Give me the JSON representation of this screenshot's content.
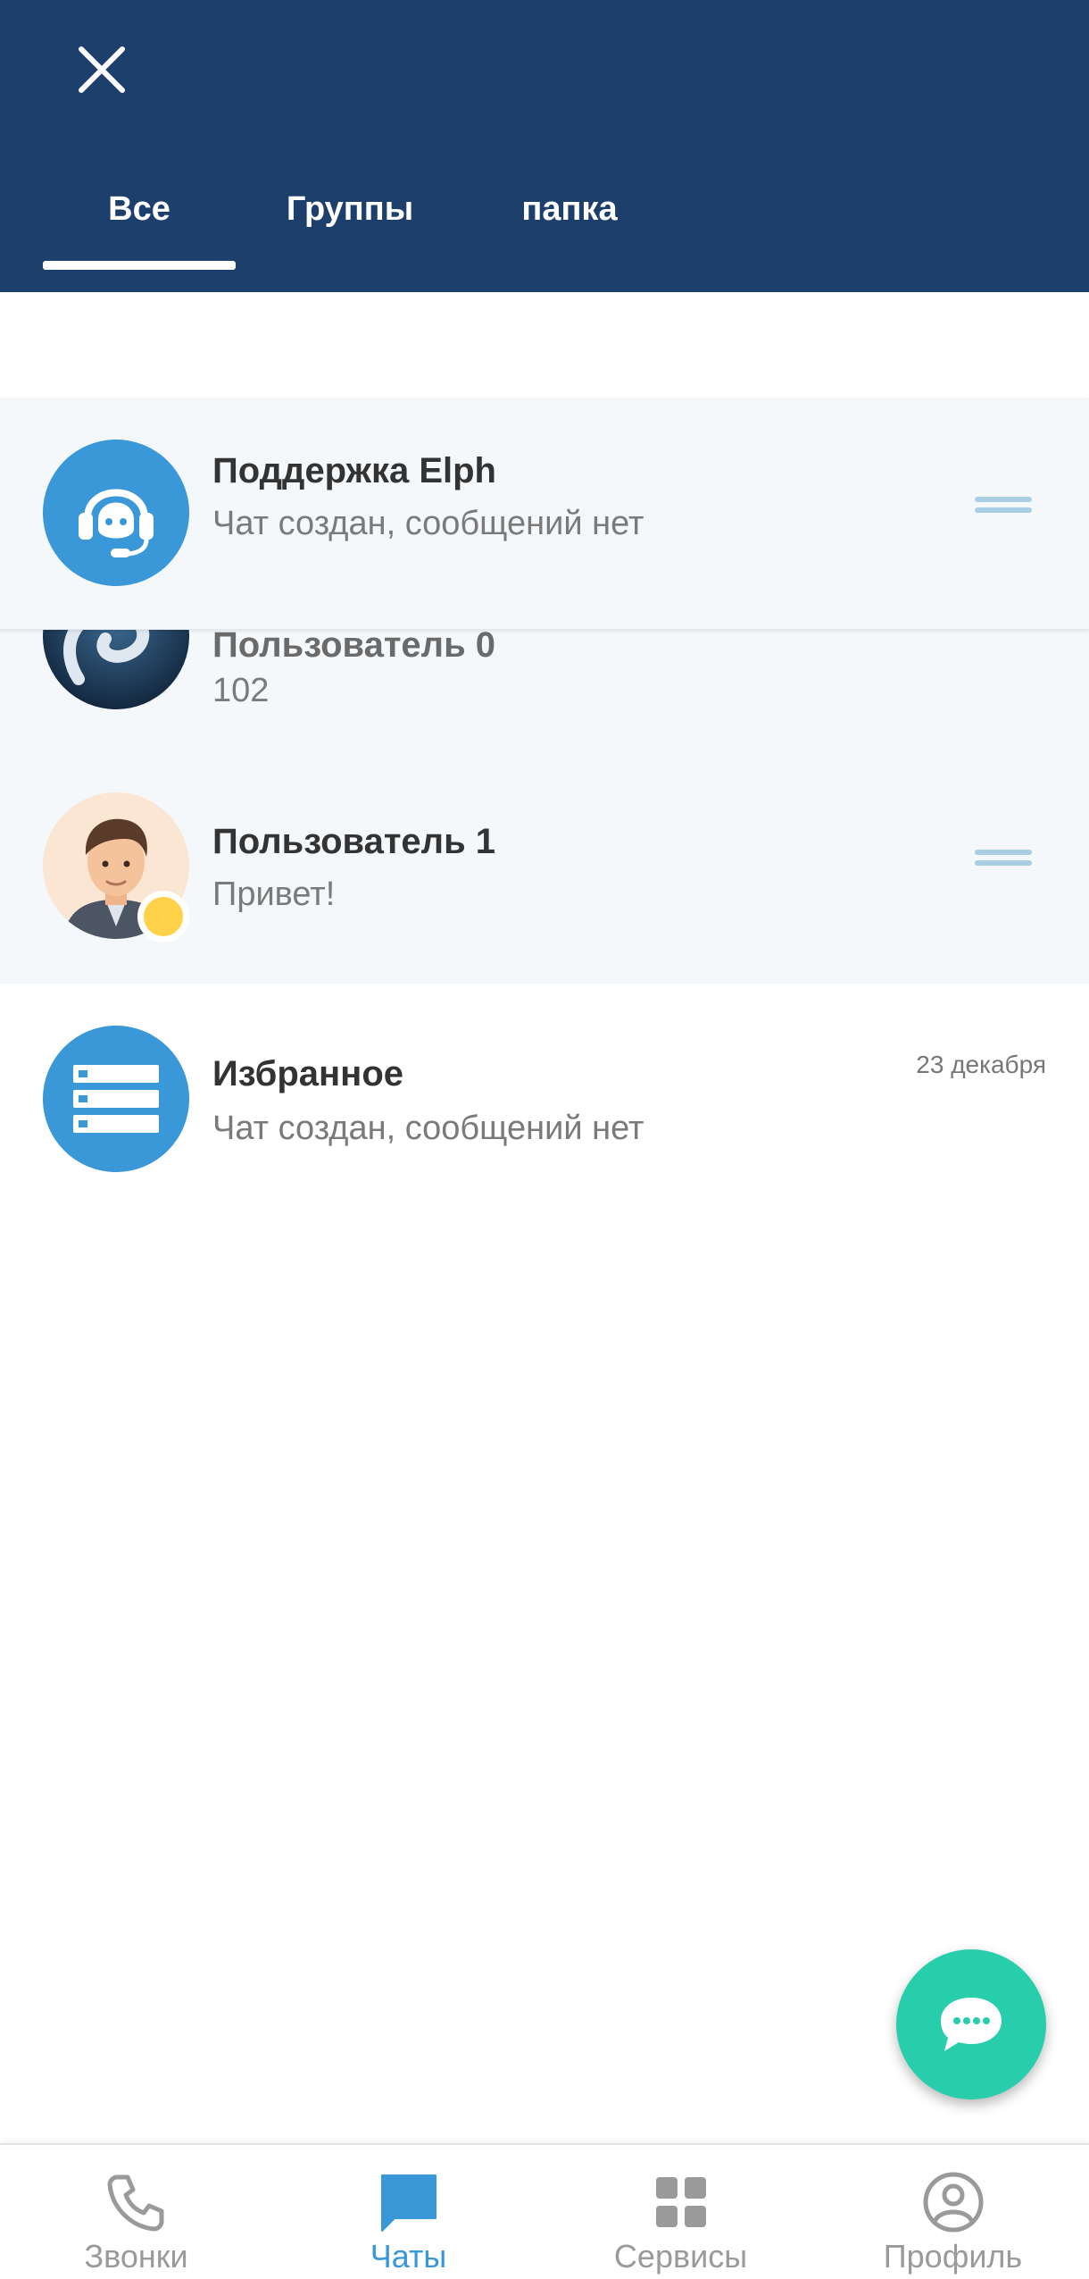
{
  "header": {
    "tabs": [
      {
        "label": "Все",
        "active": true
      },
      {
        "label": "Группы",
        "active": false
      },
      {
        "label": "папка",
        "active": false
      }
    ]
  },
  "chats": [
    {
      "name": "Поддержка Elph",
      "preview": "Чат создан, сообщений нет",
      "avatar_icon": "headset-support-icon",
      "pinned": true
    },
    {
      "name": "Пользователь 0",
      "preview": "102",
      "avatar_icon": "user-logo-avatar",
      "pinned": true
    },
    {
      "name": "Пользователь 1",
      "preview": "Привет!",
      "avatar_icon": "man-portrait-avatar",
      "status": "away",
      "pinned": true
    },
    {
      "name": "Избранное",
      "preview": "Чат создан, сообщений нет",
      "date": "23 декабря",
      "avatar_icon": "bookmark-list-icon",
      "pinned": false
    }
  ],
  "bottom_nav": [
    {
      "label": "Звонки",
      "icon": "phone-icon",
      "active": false
    },
    {
      "label": "Чаты",
      "icon": "chat-icon",
      "active": true
    },
    {
      "label": "Сервисы",
      "icon": "grid-icon",
      "active": false
    },
    {
      "label": "Профиль",
      "icon": "profile-icon",
      "active": false
    }
  ],
  "colors": {
    "header": "#1d3f6b",
    "accent": "#3a97d8",
    "fab": "#28ceab",
    "status_away": "#ffd24a",
    "pinned_background": "#f5f8fa"
  }
}
